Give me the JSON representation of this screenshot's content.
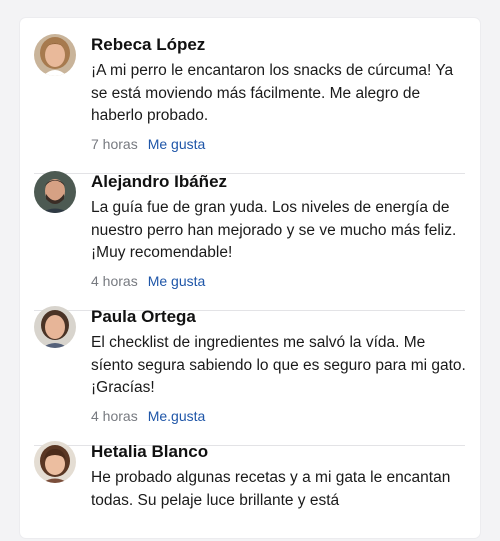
{
  "comments": [
    {
      "name": "Rebeca López",
      "text": "¡A mi perro le encantaron los snacks de cúrcuma! Ya se está moviendo más fácilmente. Me alegro de haberlo probado.",
      "time": "7 horas",
      "like_label": "Me gusta",
      "avatar": "avatar-woman-blonde"
    },
    {
      "name": "Alejandro Ibáñez",
      "text": "La guía fue de gran yuda. Los niveles de energía de nuestro perro han mejorado y se ve mucho más feliz. ¡Muy recomendable!",
      "time": "4 horas",
      "like_label": "Me gusta",
      "avatar": "avatar-man-beard"
    },
    {
      "name": "Paula Ortega",
      "text": "El checklist de ingredientes me salvó la vída. Me síento segura sabiendo lo que es seguro para mi gato. ¡Gracías!",
      "time": "4 horas",
      "like_label": "Me.gusta",
      "avatar": "avatar-woman-dark-hair"
    },
    {
      "name": "Hetalia Blanco",
      "text": "He probado algunas recetas y a mi gata le encantan todas. Su pelaje luce brillante y está",
      "time": "",
      "like_label": "",
      "avatar": "avatar-woman-bangs"
    }
  ],
  "colors": {
    "link": "#1f56a8",
    "timestamp": "#777a80",
    "divider": "#e3e3e6"
  }
}
